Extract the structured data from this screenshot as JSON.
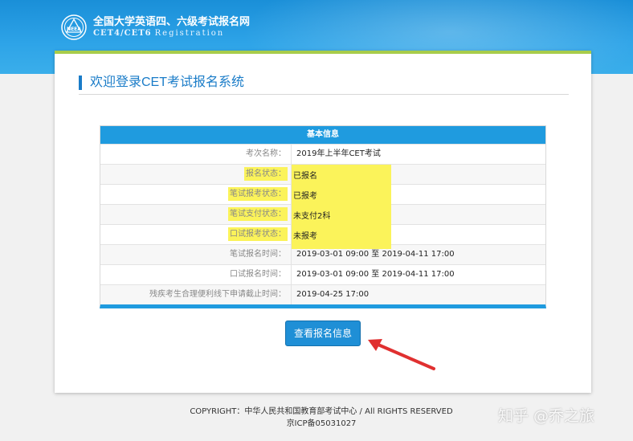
{
  "header": {
    "title_cn": "全国大学英语四、六级考试报名网",
    "title_en": "CET4/CET6",
    "title_en_reg": "Registration"
  },
  "panel": {
    "welcome": "欢迎登录CET考试报名系统",
    "table_title": "基本信息",
    "rows": [
      {
        "label": "考次名称：",
        "value": "2019年上半年CET考试",
        "highlight": false
      },
      {
        "label": "报名状态：",
        "value": "已报名",
        "highlight": true
      },
      {
        "label": "笔试报考状态：",
        "value": "已报考",
        "highlight": true
      },
      {
        "label": "笔试支付状态：",
        "value": "未支付2科",
        "highlight": true
      },
      {
        "label": "口试报考状态：",
        "value": "未报考",
        "highlight": true
      },
      {
        "label": "笔试报名时间：",
        "value": "2019-03-01 09:00 至 2019-04-11 17:00",
        "highlight": false
      },
      {
        "label": "口试报名时间：",
        "value": "2019-03-01 09:00 至 2019-04-11 17:00",
        "highlight": false
      },
      {
        "label": "残疾考生合理便利线下申请截止时间：",
        "value": "2019-04-25 17:00",
        "highlight": false
      }
    ],
    "button": "查看报名信息"
  },
  "footer": {
    "copyright": "COPYRIGHT：中华人民共和国教育部考试中心 / All RIGHTS RESERVED",
    "icp": "京ICP备05031027"
  },
  "watermark": "知乎 @乔之旅",
  "colors": {
    "header_blue": "#1a8fd8",
    "accent_green": "#a8cc4a",
    "table_blue": "#1f9bdf",
    "highlight_yellow": "#fbf35a",
    "arrow_red": "#e03030"
  }
}
